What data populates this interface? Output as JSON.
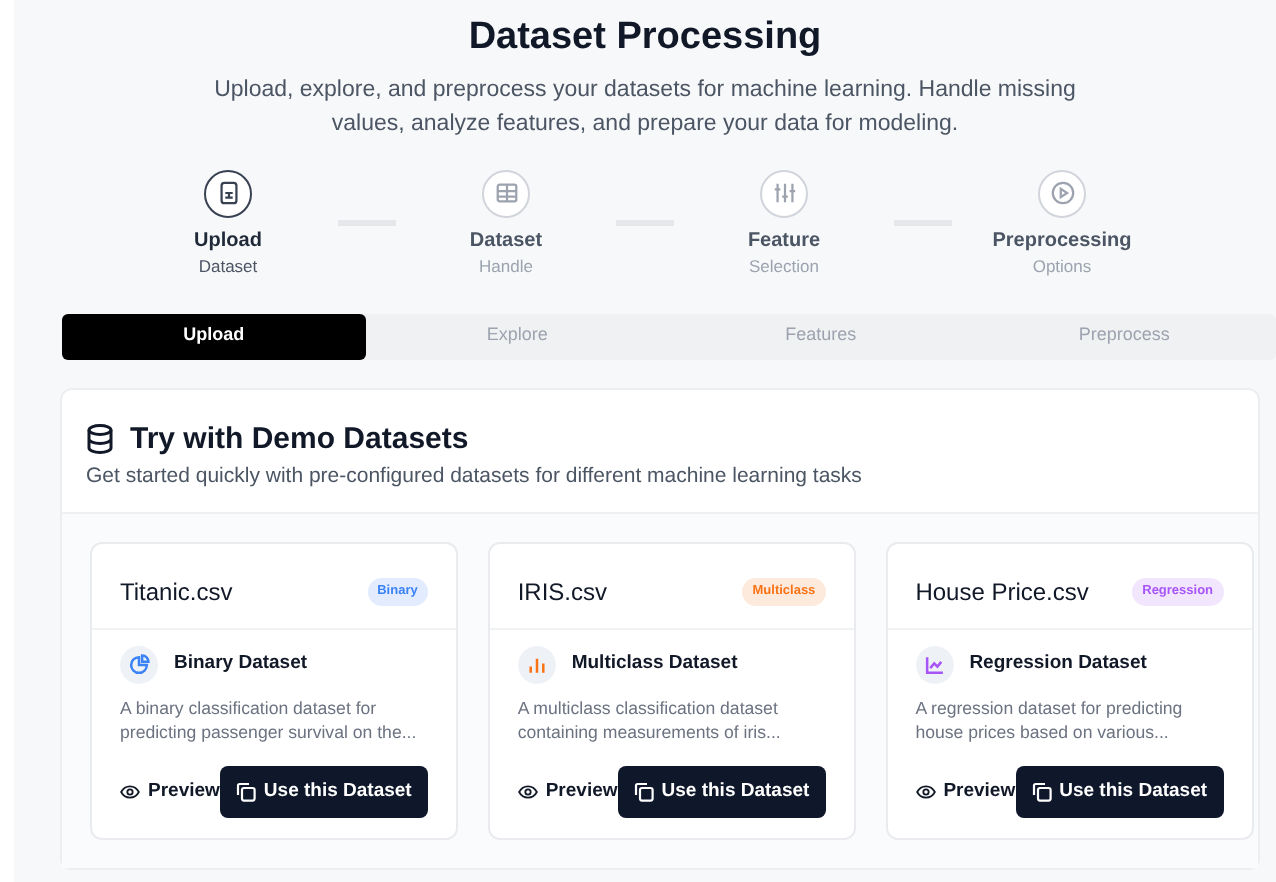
{
  "header": {
    "title": "Dataset Processing",
    "subtitle": "Upload, explore, and preprocess your datasets for machine learning. Handle missing values, analyze features, and prepare your data for modeling."
  },
  "steps": [
    {
      "title": "Upload",
      "caption": "Dataset",
      "selected": true
    },
    {
      "title": "Dataset",
      "caption": "Handle",
      "selected": false
    },
    {
      "title": "Feature",
      "caption": "Selection",
      "selected": false
    },
    {
      "title": "Preprocessing",
      "caption": "Options",
      "selected": false
    }
  ],
  "tabs": [
    {
      "label": "Upload",
      "selected": true
    },
    {
      "label": "Explore",
      "selected": false
    },
    {
      "label": "Features",
      "selected": false
    },
    {
      "label": "Preprocess",
      "selected": false
    }
  ],
  "demo": {
    "title": "Try with Demo Datasets",
    "subtitle": "Get started quickly with pre-configured datasets for different machine learning tasks",
    "datasets": [
      {
        "name": "Titanic.csv",
        "badge": "Binary",
        "color": "#3b82f6",
        "type": "Binary Dataset",
        "description": "A binary classification dataset for predicting passenger survival on the...",
        "preview": "Preview",
        "use": "Use this Dataset"
      },
      {
        "name": "IRIS.csv",
        "badge": "Multiclass",
        "color": "#f97316",
        "type": "Multiclass Dataset",
        "description": "A multiclass classification dataset containing measurements of iris...",
        "preview": "Preview",
        "use": "Use this Dataset"
      },
      {
        "name": "House Price.csv",
        "badge": "Regression",
        "color": "#a855f7",
        "type": "Regression Dataset",
        "description": "A regression dataset for predicting house prices based on various...",
        "preview": "Preview",
        "use": "Use this Dataset"
      }
    ]
  }
}
